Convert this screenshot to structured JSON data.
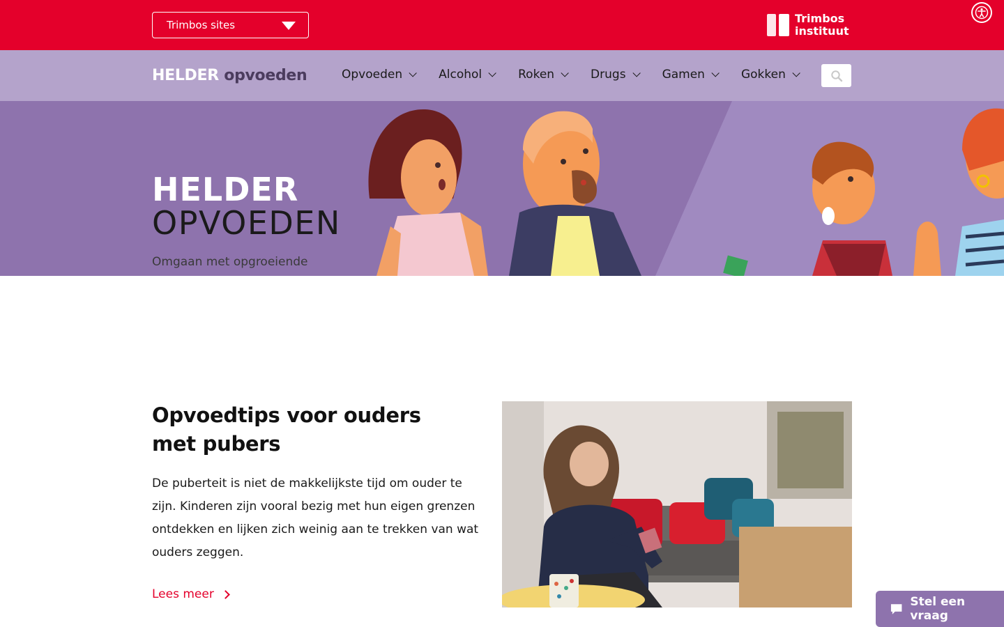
{
  "topbar": {
    "sites_label": "Trimbos sites",
    "brand_line1": "Trimbos",
    "brand_line2": "instituut"
  },
  "logo": {
    "part1": "HELDER",
    "part2": "opvoeden"
  },
  "nav": {
    "items": [
      {
        "label": "Opvoeden"
      },
      {
        "label": "Alcohol"
      },
      {
        "label": "Roken"
      },
      {
        "label": "Drugs"
      },
      {
        "label": "Gamen"
      },
      {
        "label": "Gokken"
      }
    ]
  },
  "hero": {
    "title_line1": "HELDER",
    "title_line2": "OPVOEDEN",
    "subtitle": "Omgaan met opgroeiende"
  },
  "article": {
    "title": "Opvoedtips voor ouders met pubers",
    "body": "De puberteit is niet de makkelijkste tijd om ouder te zijn. Kinderen zijn vooral bezig met hun eigen grenzen ontdekken en lijken zich weinig aan te trekken van wat ouders zeggen.",
    "read_more": "Lees meer"
  },
  "chat": {
    "label": "Stel een vraag"
  },
  "colors": {
    "brand_red": "#e4002b",
    "nav_lilac": "#b4a3cb",
    "hero_purple": "#8e73ad"
  }
}
